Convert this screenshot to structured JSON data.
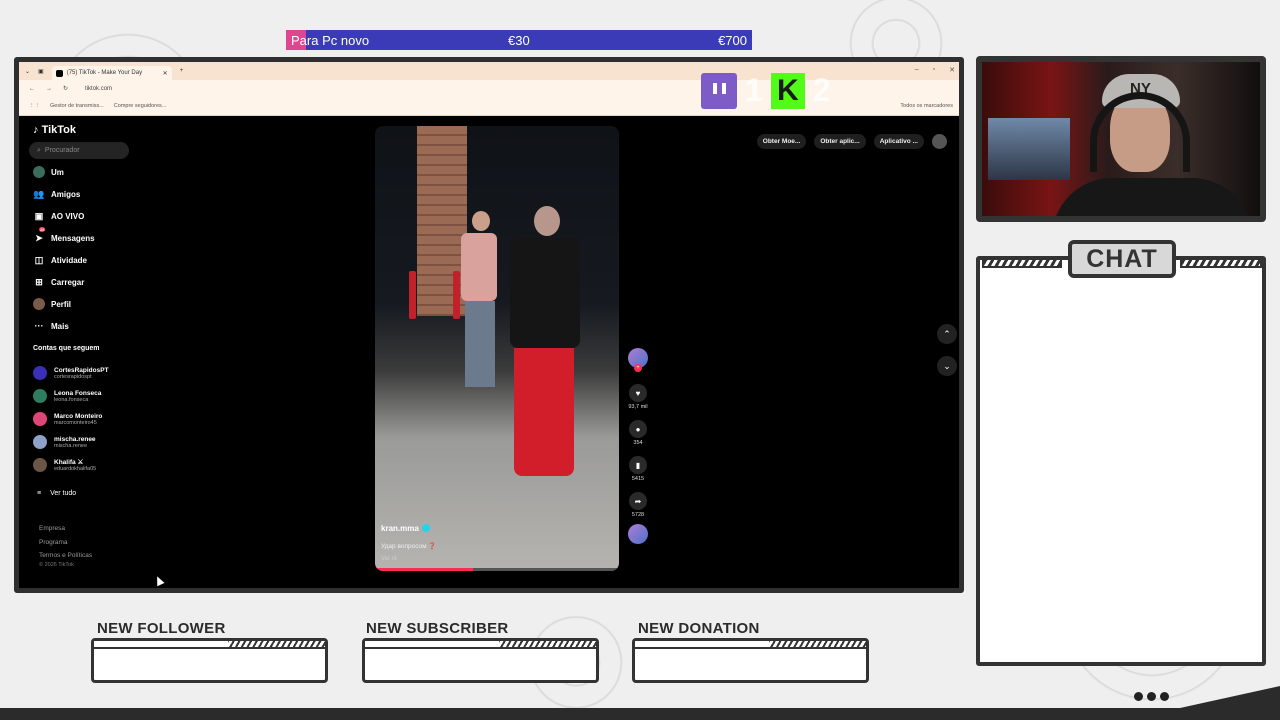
{
  "goal": {
    "label": "Para Pc novo",
    "current": "€30",
    "target": "€700",
    "progress_fraction": 0.043,
    "fill_color": "#e0458f",
    "bar_color": "#3b3bb7"
  },
  "browser": {
    "tab_title": "(75) TikTok - Make Your Day",
    "url": "tiktok.com",
    "bookmarks": [
      "Gestor de transmiss...",
      "Compre seguidores..."
    ],
    "bookmarks_right": "Todos os marcadores"
  },
  "overlay_counters": {
    "twitch_count": "1",
    "kick_count": "2",
    "twitch_color": "#7d5cc8",
    "kick_color": "#53fc18"
  },
  "tiktok": {
    "logo": "TikTok",
    "search_placeholder": "Procurador",
    "nav": [
      {
        "label": "Um",
        "icon": "avatar-icon"
      },
      {
        "label": "Amigos",
        "icon": "friends-icon"
      },
      {
        "label": "AO VIVO",
        "icon": "live-icon"
      },
      {
        "label": "Mensagens",
        "icon": "messages-icon",
        "badge": "25"
      },
      {
        "label": "Atividade",
        "icon": "activity-icon"
      },
      {
        "label": "Carregar",
        "icon": "upload-icon"
      },
      {
        "label": "Perfil",
        "icon": "profile-icon"
      },
      {
        "label": "Mais",
        "icon": "more-icon"
      }
    ],
    "following_title": "Contas que seguem",
    "following": [
      {
        "name": "CortesRapidosPT",
        "handle": "cortesrapidospt",
        "color": "#3a2fb7"
      },
      {
        "name": "Leona Fonseca",
        "handle": "leona.fonseca",
        "color": "#2e7d5f"
      },
      {
        "name": "Marco Monteiro",
        "handle": "marcomonteiro45",
        "color": "#e0457a"
      },
      {
        "name": "mischa.renee",
        "handle": "mischa.renee",
        "color": "#8da2c8"
      },
      {
        "name": "Khalifa ⚔",
        "handle": "eduardokhalifa05",
        "color": "#6b5545"
      }
    ],
    "see_all": "Ver tudo",
    "footer_links": [
      "Empresa",
      "Programa",
      "Termos e Políticas"
    ],
    "footer_copy": "© 2026 TikTok",
    "top_buttons": [
      "Obter Moe...",
      "Obter aplic...",
      "Aplicativo ..."
    ],
    "video": {
      "author": "kran.mma",
      "caption": "Удар вопросом ❓",
      "more": "Ver rê",
      "progress_fraction": 0.4
    },
    "actions": {
      "likes": "93,7 mil",
      "comments": "354",
      "saves": "5415",
      "shares": "5728"
    }
  },
  "chat": {
    "title": "CHAT"
  },
  "alerts": {
    "follower": "NEW FOLLOWER",
    "subscriber": "NEW SUBSCRIBER",
    "donation": "NEW DONATION"
  },
  "webcam": {
    "cap_logo": "NY"
  }
}
